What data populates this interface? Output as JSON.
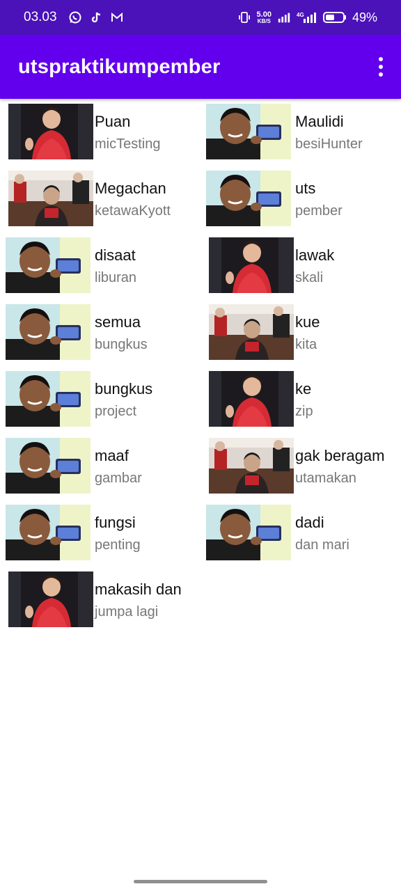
{
  "status_bar": {
    "time": "03.03",
    "icons_left": [
      "whatsapp-icon",
      "tiktok-icon",
      "gmail-icon"
    ],
    "net_speed_value": "5.00",
    "net_speed_unit": "KB/S",
    "network_type": "4G",
    "battery_percent": "49%"
  },
  "app_bar": {
    "title": "utspraktikumpember",
    "menu_icon": "more-vert-icon"
  },
  "items": [
    {
      "title": "Puan",
      "subtitle": "micTesting",
      "image": "woman-red-dress"
    },
    {
      "title": "Maulidi",
      "subtitle": "besiHunter",
      "image": "young-man-phone"
    },
    {
      "title": "Megachan",
      "subtitle": "ketawaKyott",
      "image": "woman-seated-laughing"
    },
    {
      "title": "uts",
      "subtitle": "pember",
      "image": "young-man-phone"
    },
    {
      "title": "disaat",
      "subtitle": "liburan",
      "image": "young-man-phone"
    },
    {
      "title": "lawak",
      "subtitle": "skali",
      "image": "woman-red-dress"
    },
    {
      "title": "semua",
      "subtitle": "bungkus",
      "image": "young-man-phone"
    },
    {
      "title": "kue",
      "subtitle": "kita",
      "image": "woman-seated-laughing"
    },
    {
      "title": "bungkus",
      "subtitle": "project",
      "image": "young-man-phone"
    },
    {
      "title": "ke",
      "subtitle": "zip",
      "image": "woman-red-dress"
    },
    {
      "title": "maaf",
      "subtitle": "gambar",
      "image": "young-man-phone"
    },
    {
      "title": "gak beragam",
      "subtitle": "utamakan",
      "image": "woman-seated-laughing"
    },
    {
      "title": "fungsi",
      "subtitle": "penting",
      "image": "young-man-phone"
    },
    {
      "title": "dadi",
      "subtitle": "dan mari",
      "image": "young-man-phone"
    },
    {
      "title": "makasih dan",
      "subtitle": "jumpa lagi",
      "image": "woman-red-dress"
    }
  ],
  "colors": {
    "status_bar": "#4a12b8",
    "app_bar": "#6200ee",
    "title_text": "#111111",
    "subtitle_text": "#777777"
  }
}
